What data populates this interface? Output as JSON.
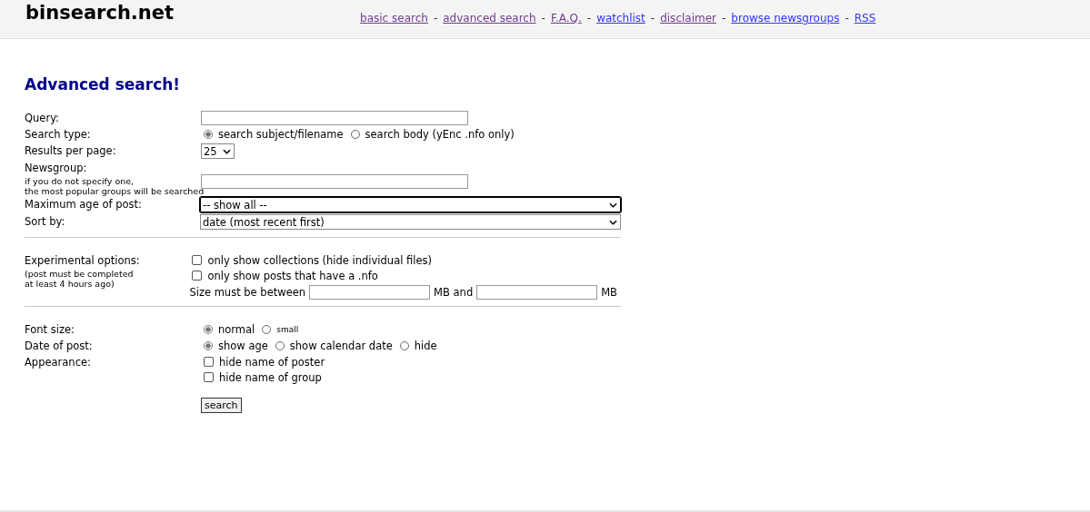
{
  "site_title": "binsearch.net",
  "nav_links": [
    {
      "label": "basic search",
      "visited": true
    },
    {
      "label": "advanced search",
      "visited": true
    },
    {
      "label": "F.A.Q.",
      "visited": true
    },
    {
      "label": "watchlist",
      "visited": false
    },
    {
      "label": "disclaimer",
      "visited": true
    },
    {
      "label": "browse newsgroups",
      "visited": false
    },
    {
      "label": "RSS",
      "visited": false
    }
  ],
  "nav_separator": "-",
  "heading": "Advanced search!",
  "sections": [
    {
      "rows": [
        {
          "label": "Query:",
          "kind": "text"
        },
        {
          "label": "Search type:",
          "kind": "radios",
          "options": [
            {
              "label": "search subject/filename",
              "selected": true
            },
            {
              "label": "search body (yEnc .nfo only)",
              "selected": false
            }
          ]
        },
        {
          "label": "Results per page:",
          "kind": "compact-select",
          "value": "25"
        },
        {
          "label": "Newsgroup:",
          "note_lines": [
            "if you do not specify one,",
            "the most popular groups will be searched"
          ],
          "kind": "text"
        },
        {
          "label": "Maximum age of post:",
          "kind": "select",
          "value": "-- show all --",
          "focused": true
        },
        {
          "label": "Sort by:",
          "kind": "select",
          "value": "date (most recent first)",
          "focused": false
        }
      ]
    },
    {
      "rows": [
        {
          "label": "Experimental options:",
          "note_lines": [
            "(post must be completed",
            "at least 4 hours ago)"
          ],
          "kind": "experimental",
          "checkboxes": [
            {
              "label": "only show collections (hide individual files)",
              "checked": false
            },
            {
              "label": "only show posts that have a .nfo",
              "checked": false
            }
          ],
          "size": {
            "label": "Size must be between",
            "middle": "MB and",
            "unit": "MB"
          }
        }
      ]
    },
    {
      "rows": [
        {
          "label": "Font size:",
          "kind": "radios",
          "options": [
            {
              "label": "normal",
              "selected": true,
              "small": false
            },
            {
              "label": "small",
              "selected": false,
              "small": true
            }
          ]
        },
        {
          "label": "Date of post:",
          "kind": "radios",
          "options": [
            {
              "label": "show age",
              "selected": true
            },
            {
              "label": "show calendar date",
              "selected": false
            },
            {
              "label": "hide",
              "selected": false
            }
          ]
        },
        {
          "label": "Appearance:",
          "kind": "checks",
          "checkboxes": [
            {
              "label": "hide name of poster",
              "checked": false
            },
            {
              "label": "hide name of group",
              "checked": false
            }
          ]
        }
      ]
    }
  ],
  "search_button": "search"
}
